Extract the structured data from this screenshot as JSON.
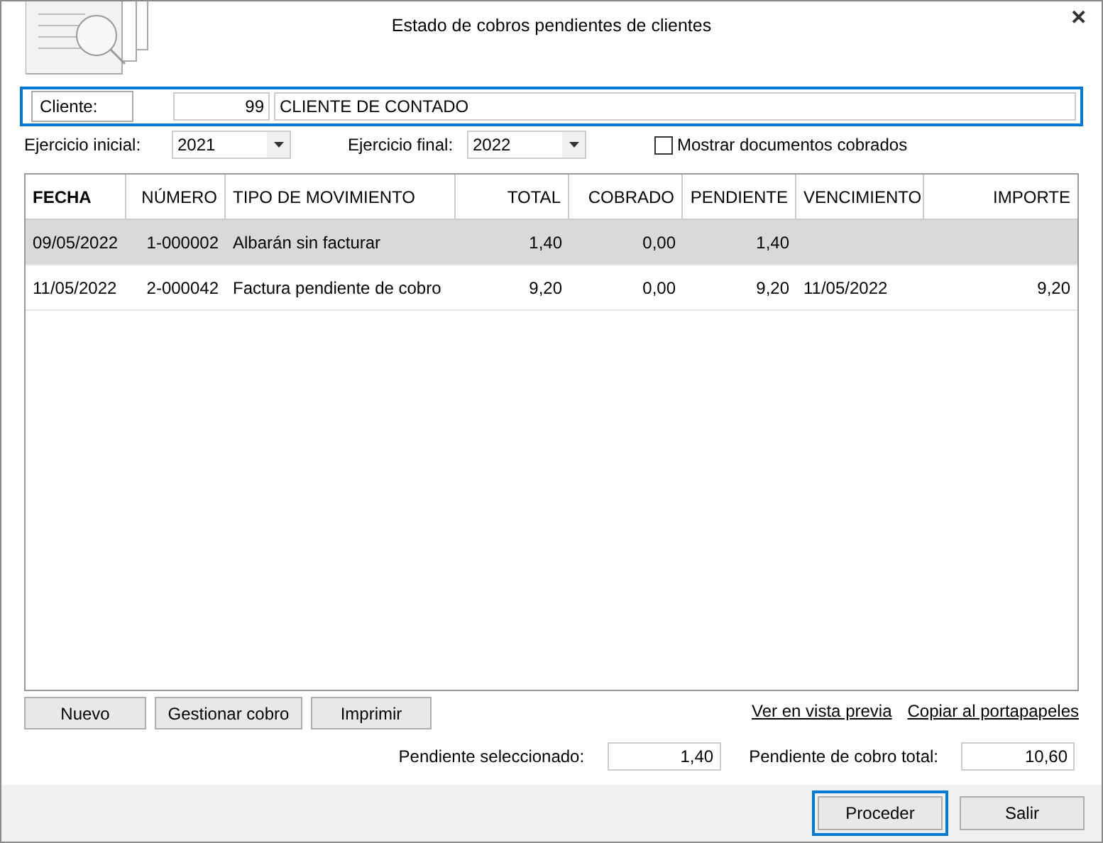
{
  "window": {
    "title": "Estado de cobros pendientes de clientes",
    "close": "✕"
  },
  "client": {
    "label": "Cliente:",
    "code": "99",
    "name": "CLIENTE DE CONTADO"
  },
  "filters": [
    {
      "label": "Ejercicio inicial:",
      "value": "2021"
    },
    {
      "label": "Ejercicio final:",
      "value": "2022"
    }
  ],
  "show_paid": {
    "label": "Mostrar documentos cobrados",
    "checked": false
  },
  "table": {
    "columns": [
      "FECHA",
      "NÚMERO",
      "TIPO DE MOVIMIENTO",
      "TOTAL",
      "COBRADO",
      "PENDIENTE",
      "VENCIMIENTO",
      "IMPORTE"
    ],
    "rows": [
      {
        "selected": true,
        "cells": [
          "09/05/2022",
          "1-000002",
          "Albarán sin facturar",
          "1,40",
          "0,00",
          "1,40",
          "",
          ""
        ]
      },
      {
        "selected": false,
        "cells": [
          "11/05/2022",
          "2-000042",
          "Factura pendiente de cobro",
          "9,20",
          "0,00",
          "9,20",
          "11/05/2022",
          "9,20"
        ]
      }
    ]
  },
  "actions": [
    "Nuevo",
    "Gestionar cobro",
    "Imprimir"
  ],
  "links": [
    "Ver en vista previa",
    "Copiar al portapapeles"
  ],
  "totals": [
    {
      "label": "Pendiente seleccionado:",
      "value": "1,40"
    },
    {
      "label": "Pendiente de cobro total:",
      "value": "10,60"
    }
  ],
  "footer_buttons": [
    {
      "label": "Proceder",
      "focused": true
    },
    {
      "label": "Salir",
      "focused": false
    }
  ]
}
